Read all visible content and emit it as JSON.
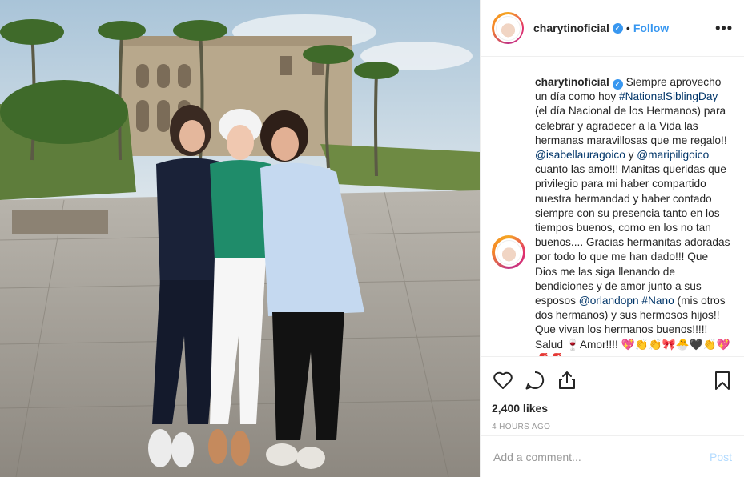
{
  "post": {
    "username": "charytinoficial",
    "verified_glyph": "✓",
    "dot": "•",
    "follow_label": "Follow",
    "more_glyph": "•••",
    "caption_username": "charytinoficial",
    "caption_parts": {
      "p1": " Siempre aprovecho un día como hoy ",
      "tag1": "#NationalSiblingDay",
      "p2": " (el día Nacional de los Hermanos) para celebrar y agradecer a la Vida las hermanas maravillosas que me regalo!! ",
      "mention1": "@isabellauragoico",
      "p3": " y ",
      "mention2": "@maripiligoico",
      "p4": " cuanto las amo!!! Manitas queridas que privilegio para mi haber compartido nuestra hermandad y haber contado siempre con su presencia tanto en los tiempos buenos, como en los no tan buenos.... Gracias hermanitas adoradas por todo lo que me han dado!!! Que Dios me las siga llenando de bendiciones y de amor junto a sus esposos ",
      "mention3": "@orlandopn",
      "p5": " ",
      "tag2": "#Nano",
      "p6": " (mis otros dos hermanos) y sus hermosos hijos!! Que vivan los hermanos buenos!!!!! Salud 🍷Amor!!!! 💖👏👏🎀🐣🖤👏💖💋💋"
    },
    "likes": "2,400 likes",
    "time": "4 HOURS AGO",
    "comment_placeholder": "Add a comment...",
    "post_label": "Post"
  },
  "icons": {
    "like": "heart-icon",
    "comment": "comment-icon",
    "share": "share-icon",
    "save": "bookmark-icon",
    "verified": "verified-badge-icon",
    "more": "more-options-icon"
  },
  "colors": {
    "link": "#003569",
    "accent": "#3897f0",
    "post_disabled": "#b3dbff",
    "muted": "#999999"
  }
}
